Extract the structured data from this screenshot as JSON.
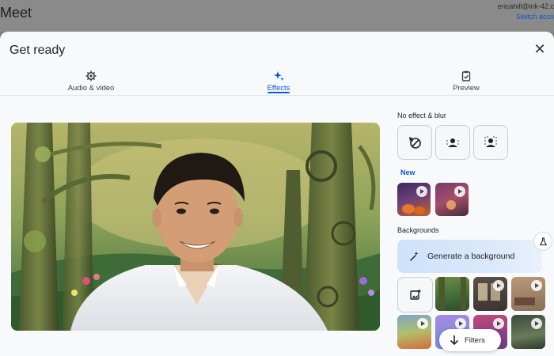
{
  "app": {
    "title": "Meet"
  },
  "account": {
    "email": "ericahill@ink-42.c",
    "switch_label": "Switch acco"
  },
  "dialog": {
    "title": "Get ready",
    "close_icon": "close-icon"
  },
  "tabs": [
    {
      "label": "Audio & video",
      "icon": "settings-gear-icon",
      "active": false
    },
    {
      "label": "Effects",
      "icon": "sparkle-icon",
      "active": true
    },
    {
      "label": "Preview",
      "icon": "clipboard-check-icon",
      "active": false
    }
  ],
  "effects": {
    "no_effect_label": "No effect & blur",
    "effect_buttons": [
      {
        "icon": "no-effect-icon"
      },
      {
        "icon": "slight-blur-icon"
      },
      {
        "icon": "full-blur-icon"
      }
    ],
    "new_label": "New",
    "backgrounds_label": "Backgrounds",
    "generate_label": "Generate a background",
    "filters_label": "Filters"
  },
  "colors": {
    "accent": "#0b57d0",
    "dialog_bg": "#f8f9fb"
  }
}
